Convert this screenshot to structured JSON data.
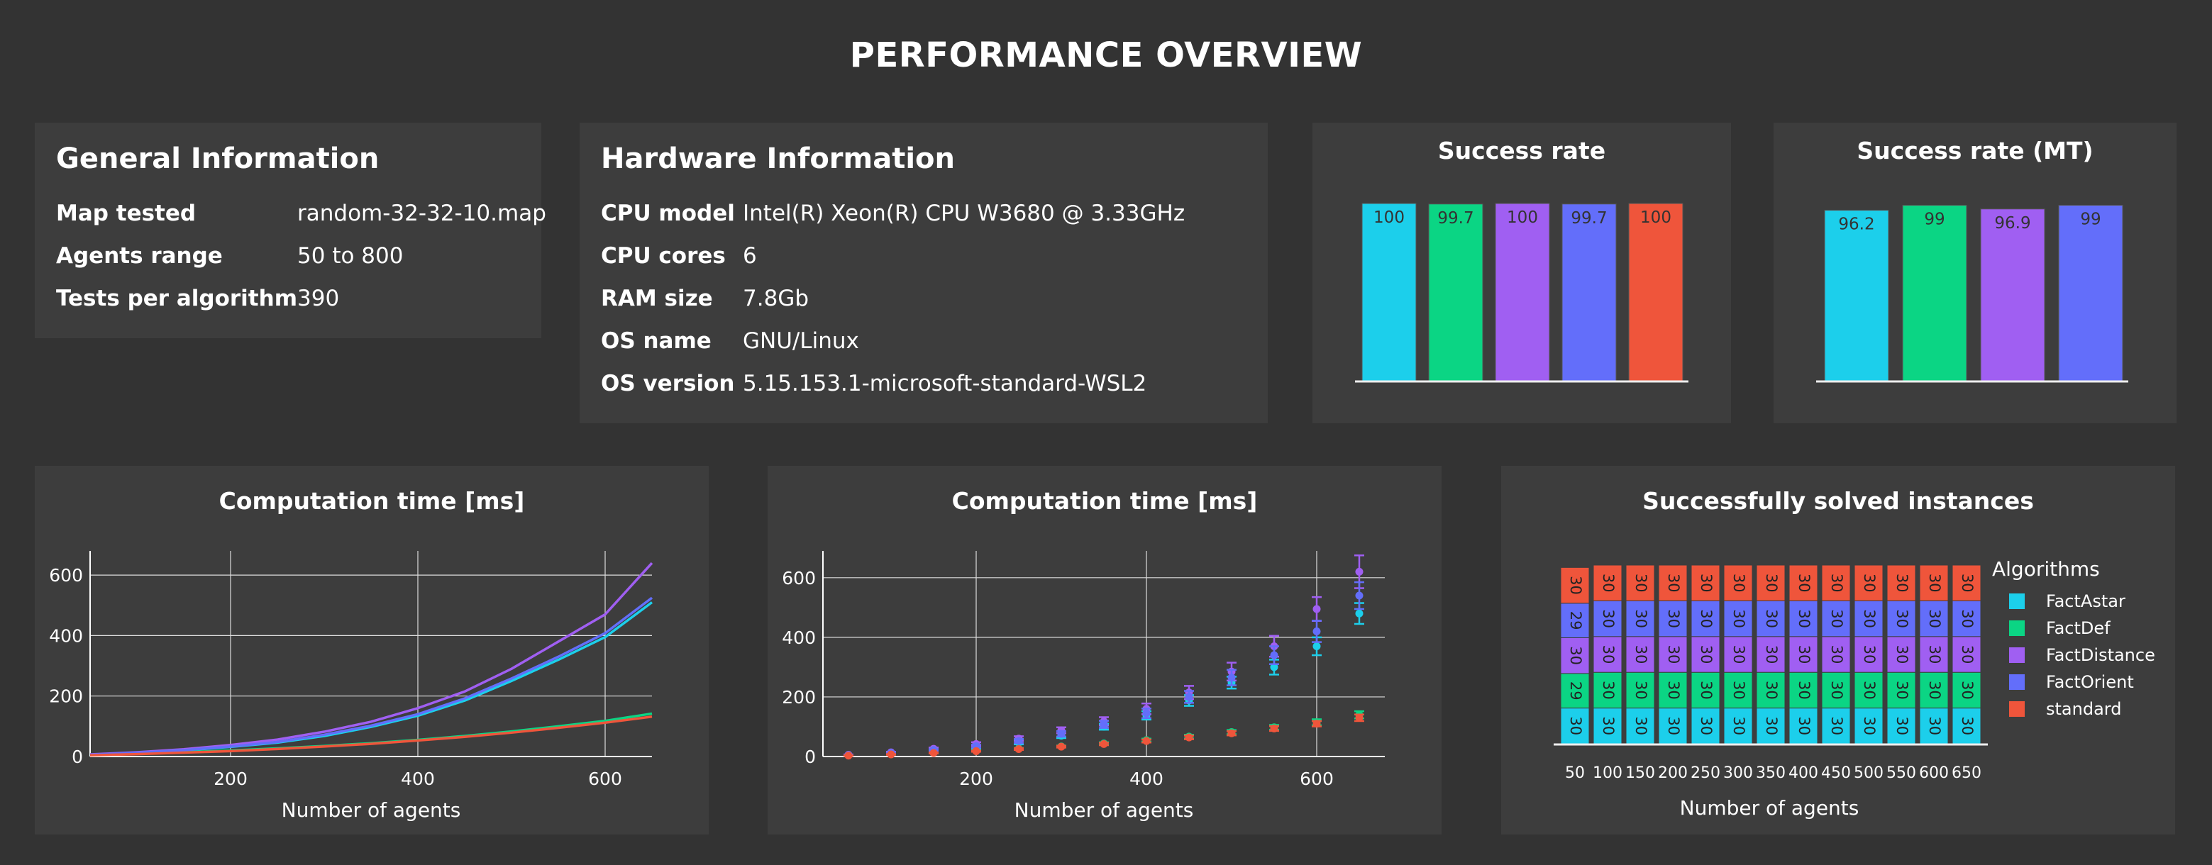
{
  "page_title": "PERFORMANCE OVERVIEW",
  "general": {
    "title": "General Information",
    "rows": [
      {
        "label": "Map tested",
        "value": "random-32-32-10.map"
      },
      {
        "label": "Agents range",
        "value": "50 to 800"
      },
      {
        "label": "Tests per algorithm",
        "value": "390"
      }
    ]
  },
  "hardware": {
    "title": "Hardware Information",
    "rows": [
      {
        "label": "CPU model",
        "value": "Intel(R) Xeon(R) CPU W3680 @ 3.33GHz"
      },
      {
        "label": "CPU cores",
        "value": "6"
      },
      {
        "label": "RAM size",
        "value": "7.8Gb"
      },
      {
        "label": "OS name",
        "value": "GNU/Linux"
      },
      {
        "label": "OS version",
        "value": "5.15.153.1-microsoft-standard-WSL2"
      }
    ]
  },
  "colors": {
    "FactAstar": "#1ccfeb",
    "FactDef": "#0bd584",
    "FactDistance": "#a05ff2",
    "FactOrient": "#636efa",
    "standard": "#ef553b"
  },
  "chart_data": [
    {
      "id": "success-rate",
      "type": "bar",
      "title": "Success rate",
      "categories": [
        "FactAstar",
        "FactDef",
        "FactDistance",
        "FactOrient",
        "standard"
      ],
      "values": [
        100,
        99.7,
        100,
        99.7,
        100
      ],
      "labels": [
        "100",
        "99.7",
        "100",
        "99.7",
        "100"
      ],
      "ylim": [
        0,
        100
      ]
    },
    {
      "id": "success-rate-mt",
      "type": "bar",
      "title": "Success rate (MT)",
      "categories": [
        "FactAstar",
        "FactDef",
        "FactDistance",
        "FactOrient"
      ],
      "values": [
        96.2,
        99,
        96.9,
        99
      ],
      "labels": [
        "96.2",
        "99",
        "96.9",
        "99"
      ],
      "ylim": [
        0,
        100
      ]
    },
    {
      "id": "computation-time-lines",
      "type": "line",
      "title": "Computation time [ms]",
      "xlabel": "Number of agents",
      "ylabel": "",
      "xlim": [
        50,
        650
      ],
      "ylim": [
        0,
        680
      ],
      "xticks": [
        200,
        400,
        600
      ],
      "yticks": [
        0,
        200,
        400,
        600
      ],
      "x": [
        50,
        100,
        150,
        200,
        250,
        300,
        350,
        400,
        450,
        500,
        550,
        600,
        650
      ],
      "series": [
        {
          "name": "FactAstar",
          "values": [
            6,
            12,
            20,
            32,
            46,
            68,
            98,
            135,
            185,
            250,
            320,
            395,
            510
          ]
        },
        {
          "name": "FactDef",
          "values": [
            5,
            9,
            14,
            20,
            27,
            35,
            44,
            55,
            68,
            83,
            100,
            118,
            142
          ]
        },
        {
          "name": "FactDistance",
          "values": [
            7,
            14,
            24,
            38,
            56,
            82,
            115,
            160,
            215,
            290,
            380,
            470,
            640
          ]
        },
        {
          "name": "FactOrient",
          "values": [
            6,
            12,
            21,
            33,
            48,
            72,
            102,
            140,
            192,
            258,
            330,
            408,
            525
          ]
        },
        {
          "name": "standard",
          "values": [
            4,
            8,
            13,
            18,
            25,
            33,
            42,
            53,
            65,
            79,
            95,
            112,
            132
          ]
        }
      ]
    },
    {
      "id": "computation-time-errorbars",
      "type": "scatter",
      "title": "Computation time [ms]",
      "xlabel": "Number of agents",
      "ylabel": "",
      "xlim": [
        20,
        680
      ],
      "ylim": [
        0,
        690
      ],
      "xticks": [
        200,
        400,
        600
      ],
      "yticks": [
        0,
        200,
        400,
        600
      ],
      "x": [
        50,
        100,
        150,
        200,
        250,
        300,
        350,
        400,
        450,
        500,
        550,
        600,
        650
      ],
      "series": [
        {
          "name": "FactAstar",
          "values": [
            5,
            11,
            20,
            32,
            47,
            70,
            100,
            138,
            188,
            248,
            300,
            370,
            480
          ],
          "err": [
            1,
            2,
            3,
            5,
            6,
            8,
            10,
            14,
            18,
            20,
            25,
            30,
            35
          ]
        },
        {
          "name": "FactDef",
          "values": [
            4,
            8,
            13,
            19,
            26,
            34,
            44,
            55,
            67,
            82,
            98,
            115,
            140
          ],
          "err": [
            1,
            1,
            2,
            2,
            3,
            3,
            4,
            5,
            6,
            7,
            8,
            10,
            12
          ]
        },
        {
          "name": "FactDistance",
          "values": [
            6,
            14,
            26,
            42,
            60,
            88,
            118,
            160,
            215,
            285,
            370,
            495,
            620
          ],
          "err": [
            1,
            2,
            4,
            6,
            8,
            10,
            14,
            18,
            22,
            30,
            35,
            40,
            55
          ]
        },
        {
          "name": "FactOrient",
          "values": [
            5,
            12,
            22,
            35,
            52,
            76,
            108,
            145,
            200,
            265,
            340,
            420,
            540
          ],
          "err": [
            1,
            2,
            3,
            5,
            7,
            9,
            12,
            16,
            20,
            26,
            30,
            36,
            45
          ]
        },
        {
          "name": "standard",
          "values": [
            3,
            7,
            12,
            18,
            25,
            33,
            42,
            52,
            64,
            78,
            94,
            110,
            130
          ],
          "err": [
            1,
            1,
            2,
            2,
            3,
            3,
            4,
            5,
            6,
            7,
            8,
            9,
            11
          ]
        }
      ]
    },
    {
      "id": "solved-instances",
      "type": "bar",
      "stacked": true,
      "title": "Successfully solved instances",
      "xlabel": "Number of agents",
      "categories": [
        "50",
        "100",
        "150",
        "200",
        "250",
        "300",
        "350",
        "400",
        "450",
        "500",
        "550",
        "600",
        "650"
      ],
      "legend_title": "Algorithms",
      "legend_position": "right",
      "series": [
        {
          "name": "FactAstar",
          "values": [
            30,
            30,
            30,
            30,
            30,
            30,
            30,
            30,
            30,
            30,
            30,
            30,
            30
          ]
        },
        {
          "name": "FactDef",
          "values": [
            29,
            30,
            30,
            30,
            30,
            30,
            30,
            30,
            30,
            30,
            30,
            30,
            30
          ]
        },
        {
          "name": "FactDistance",
          "values": [
            30,
            30,
            30,
            30,
            30,
            30,
            30,
            30,
            30,
            30,
            30,
            30,
            30
          ]
        },
        {
          "name": "FactOrient",
          "values": [
            29,
            30,
            30,
            30,
            30,
            30,
            30,
            30,
            30,
            30,
            30,
            30,
            30
          ]
        },
        {
          "name": "standard",
          "values": [
            30,
            30,
            30,
            30,
            30,
            30,
            30,
            30,
            30,
            30,
            30,
            30,
            30
          ]
        }
      ]
    }
  ]
}
